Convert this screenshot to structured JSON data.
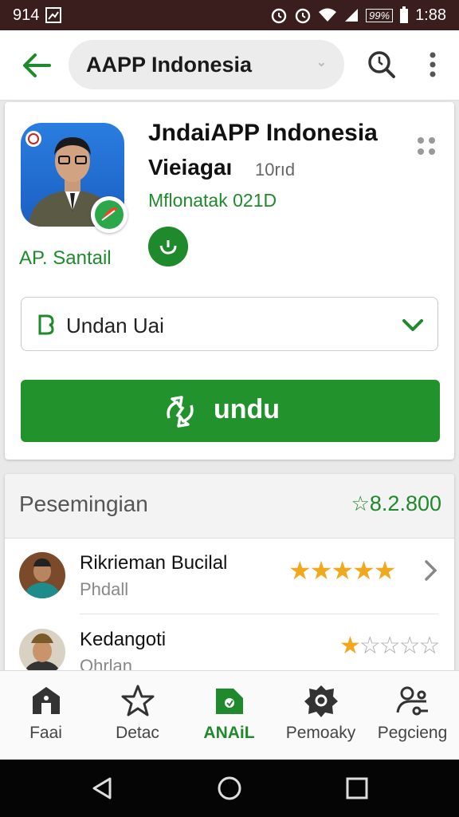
{
  "status_bar": {
    "left_text": "914",
    "time": "1:88",
    "battery_label": "99%",
    "icons": [
      "image-icon",
      "alarm-icon",
      "alarm-icon",
      "wifi-icon",
      "signal-icon",
      "battery-icon"
    ]
  },
  "top_bar": {
    "search_text": "AAPP Indonesia",
    "icons": [
      "back-arrow-icon",
      "search-icon",
      "more-vert-icon"
    ]
  },
  "app": {
    "title": "JndaiAPP Indonesia",
    "subtitle": "Vieiagaı",
    "version": "10rıd",
    "publisher": "Mflonatak 021D",
    "developer_label": "AP. Santail",
    "dropdown_label": "Undan Uai",
    "install_label": "undu",
    "accent_color": "#22922c"
  },
  "reviews": {
    "title": "Pesemingian",
    "count": "8.2.800",
    "items": [
      {
        "name": "Rikrieman Bucilal",
        "sub": "Phdall",
        "stars": "★★★★★",
        "rating": 5
      },
      {
        "name": "Kedangoti",
        "sub": "Ohrlan",
        "stars": "★☆☆☆☆",
        "rating": 1
      }
    ]
  },
  "bottom_nav": {
    "items": [
      {
        "label": "Faai",
        "icon": "home-icon"
      },
      {
        "label": "Detac",
        "icon": "star-icon"
      },
      {
        "label": "ANAiL",
        "icon": "apps-tag-icon",
        "active": true
      },
      {
        "label": "Pemoaky",
        "icon": "badge-icon"
      },
      {
        "label": "Pegcieng",
        "icon": "account-settings-icon"
      }
    ]
  },
  "system_nav": {
    "icons": [
      "back-triangle-icon",
      "home-circle-icon",
      "recents-square-icon"
    ]
  }
}
